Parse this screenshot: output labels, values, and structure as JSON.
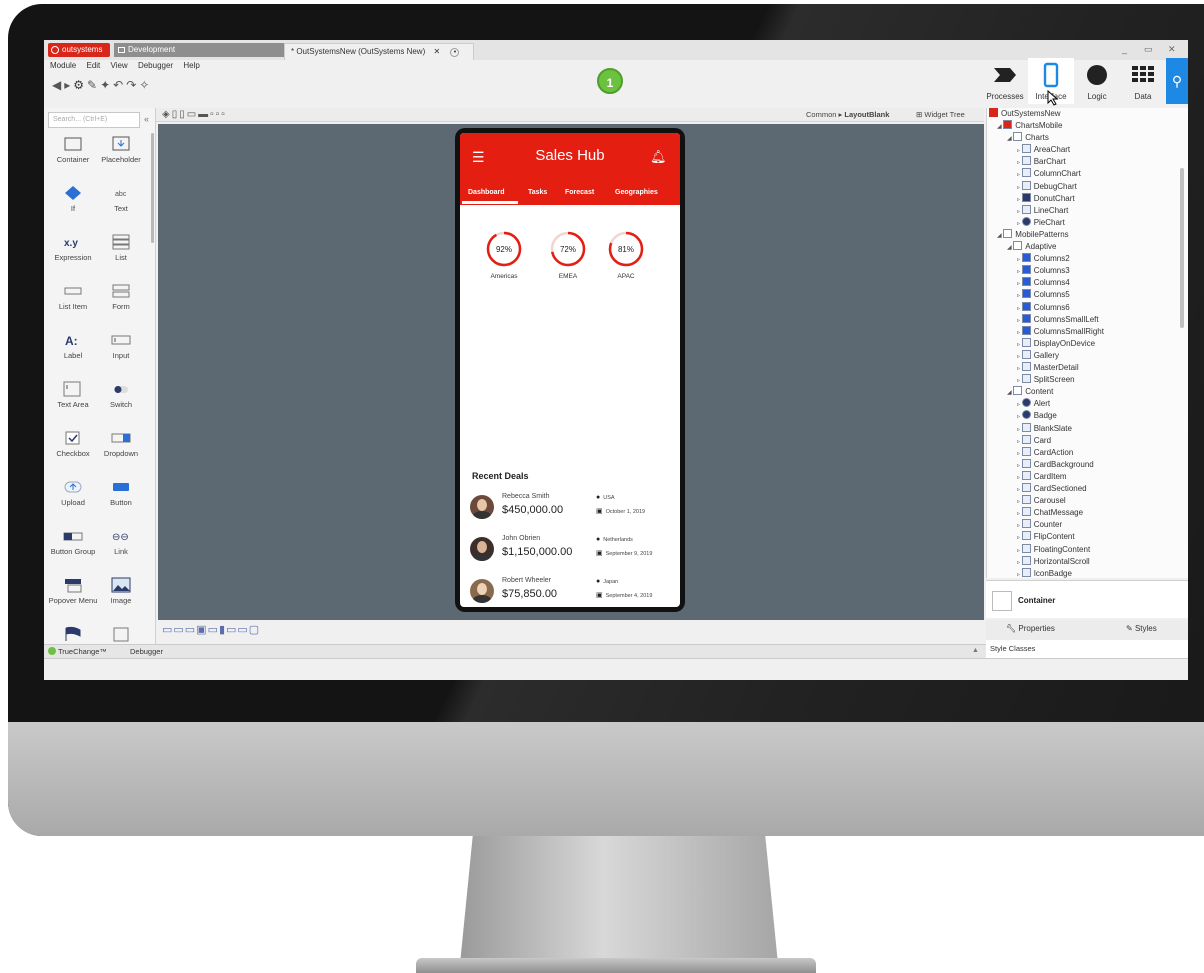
{
  "window": {
    "brand": "outsystems",
    "environment_tab": "Development",
    "document_tab": "* OutSystemsNew (OutSystems New)",
    "controls": [
      "_",
      "▭",
      "✕"
    ]
  },
  "menu": [
    "Module",
    "Edit",
    "View",
    "Debugger",
    "Help"
  ],
  "publish": {
    "label": "1"
  },
  "top_tabs": [
    {
      "label": "Processes"
    },
    {
      "label": "Interface"
    },
    {
      "label": "Logic"
    },
    {
      "label": "Data"
    }
  ],
  "left_panel": {
    "search_placeholder": "Search... (Ctrl+E)",
    "collapse": "«",
    "widgets": [
      "Container",
      "Placeholder",
      "If",
      "Text",
      "Expression",
      "List",
      "List Item",
      "Form",
      "Label",
      "Input",
      "Text Area",
      "Switch",
      "Checkbox",
      "Dropdown",
      "Upload",
      "Button",
      "Button Group",
      "Link",
      "Popover Menu",
      "Image"
    ]
  },
  "canvas_toolbar": {
    "breadcrumb_root": "Common",
    "breadcrumb_sep": "▸",
    "breadcrumb_current": "LayoutBlank",
    "widget_tree": "Widget Tree"
  },
  "app": {
    "title": "Sales Hub",
    "tabs": [
      "Dashboard",
      "Tasks",
      "Forecast",
      "Geographies"
    ],
    "gauges": [
      {
        "label": "Americas",
        "value": 92,
        "display": "92%"
      },
      {
        "label": "EMEA",
        "value": 72,
        "display": "72%"
      },
      {
        "label": "APAC",
        "value": 81,
        "display": "81%"
      }
    ],
    "recent_deals_title": "Recent Deals",
    "deals": [
      {
        "name": "Rebecca Smith",
        "amount": "$450,000.00",
        "location": "USA",
        "date": "October 1, 2019"
      },
      {
        "name": "John Obrien",
        "amount": "$1,150,000.00",
        "location": "Netherlands",
        "date": "September 9, 2019"
      },
      {
        "name": "Robert Wheeler",
        "amount": "$75,850.00",
        "location": "Japan",
        "date": "September 4, 2019"
      }
    ]
  },
  "tree": {
    "root": "OutSystemsNew",
    "items": [
      {
        "label": "ChartsMobile",
        "level": 1
      },
      {
        "label": "Charts",
        "level": 2
      },
      {
        "label": "AreaChart",
        "level": 3
      },
      {
        "label": "BarChart",
        "level": 3
      },
      {
        "label": "ColumnChart",
        "level": 3
      },
      {
        "label": "DebugChart",
        "level": 3
      },
      {
        "label": "DonutChart",
        "level": 3
      },
      {
        "label": "LineChart",
        "level": 3
      },
      {
        "label": "PieChart",
        "level": 3
      },
      {
        "label": "MobilePatterns",
        "level": 1
      },
      {
        "label": "Adaptive",
        "level": 2
      },
      {
        "label": "Columns2",
        "level": 3
      },
      {
        "label": "Columns3",
        "level": 3
      },
      {
        "label": "Columns4",
        "level": 3
      },
      {
        "label": "Columns5",
        "level": 3
      },
      {
        "label": "Columns6",
        "level": 3
      },
      {
        "label": "ColumnsSmallLeft",
        "level": 3
      },
      {
        "label": "ColumnsSmallRight",
        "level": 3
      },
      {
        "label": "DisplayOnDevice",
        "level": 3
      },
      {
        "label": "Gallery",
        "level": 3
      },
      {
        "label": "MasterDetail",
        "level": 3
      },
      {
        "label": "SplitScreen",
        "level": 3
      },
      {
        "label": "Content",
        "level": 2
      },
      {
        "label": "Alert",
        "level": 3
      },
      {
        "label": "Badge",
        "level": 3
      },
      {
        "label": "BlankSlate",
        "level": 3
      },
      {
        "label": "Card",
        "level": 3
      },
      {
        "label": "CardAction",
        "level": 3
      },
      {
        "label": "CardBackground",
        "level": 3
      },
      {
        "label": "CardItem",
        "level": 3
      },
      {
        "label": "CardSectioned",
        "level": 3
      },
      {
        "label": "Carousel",
        "level": 3
      },
      {
        "label": "ChatMessage",
        "level": 3
      },
      {
        "label": "Counter",
        "level": 3
      },
      {
        "label": "FlipContent",
        "level": 3
      },
      {
        "label": "FloatingContent",
        "level": 3
      },
      {
        "label": "HorizontalScroll",
        "level": 3
      },
      {
        "label": "IconBadge",
        "level": 3
      }
    ]
  },
  "properties": {
    "selected": "Container",
    "tab_properties": "Properties",
    "tab_styles": "Styles",
    "style_classes": "Style Classes"
  },
  "status": {
    "truechange": "TrueChange™",
    "debugger": "Debugger"
  },
  "colors": {
    "brand_red": "#e41f12",
    "canvas": "#5c6972",
    "publish_green": "#6cc23e",
    "accent_blue": "#1e88e5"
  }
}
